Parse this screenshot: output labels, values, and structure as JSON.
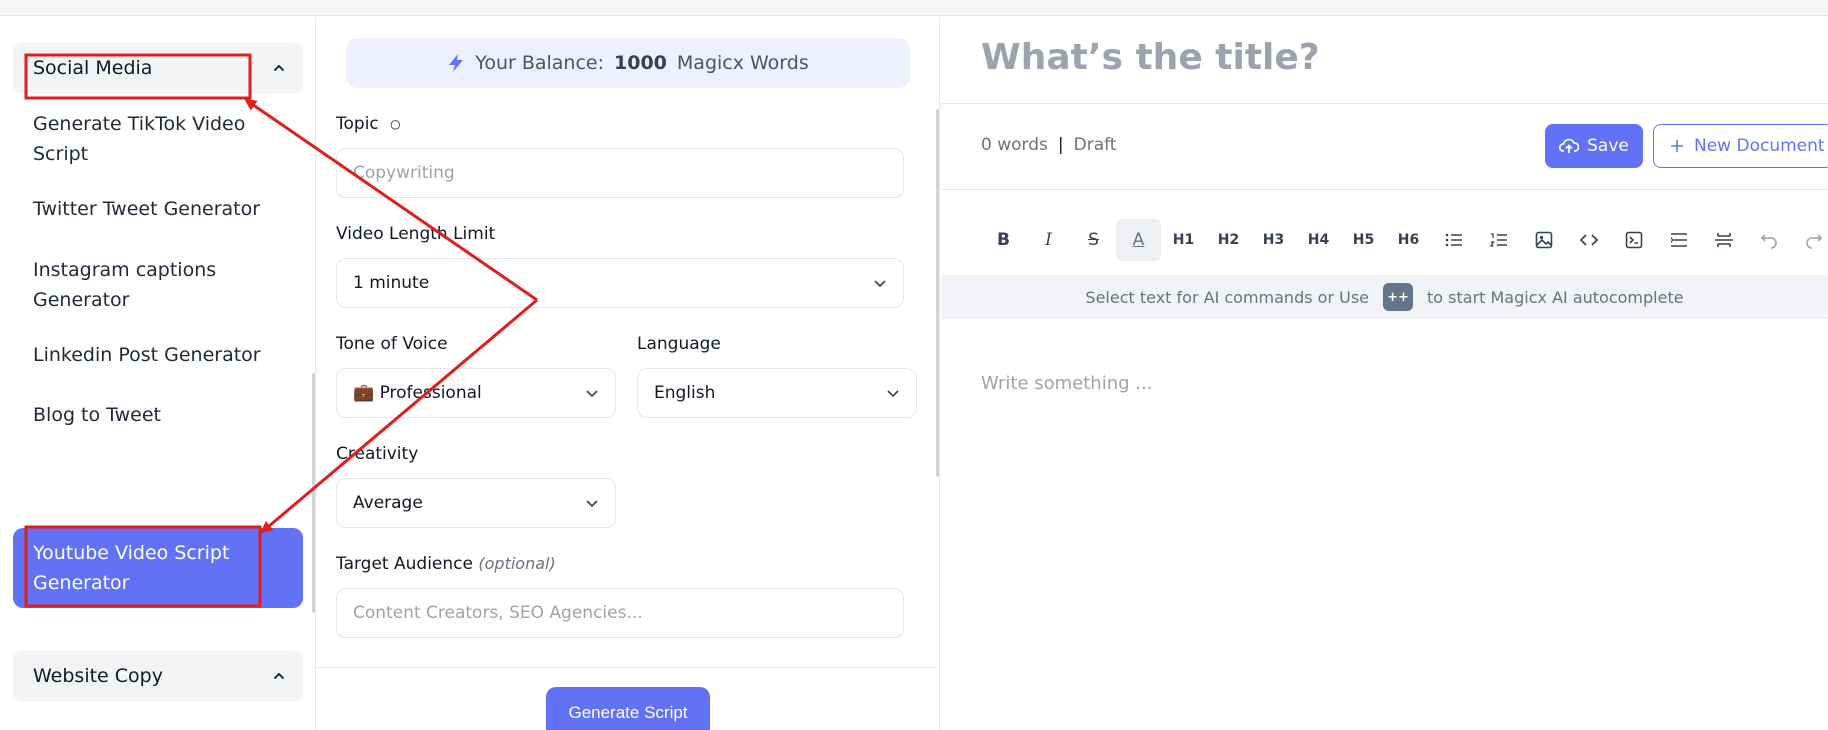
{
  "sidebar": {
    "categories": [
      {
        "label": "Social Media"
      },
      {
        "label": "Website Copy"
      }
    ],
    "items": [
      {
        "label": "Generate TikTok Video Script"
      },
      {
        "label": "Twitter Tweet Generator"
      },
      {
        "label": "Instagram captions Generator"
      },
      {
        "label": "Linkedin Post Generator"
      },
      {
        "label": "Blog to Tweet"
      },
      {
        "label": "Youtube Video Script Generator"
      }
    ]
  },
  "form": {
    "balance_prefix": "Your Balance:",
    "balance_value": "1000",
    "balance_suffix": "Magicx Words",
    "topic_label": "Topic",
    "topic_placeholder": "Copywriting",
    "video_length_label": "Video Length Limit",
    "video_length_value": "1 minute",
    "tone_label": "Tone of Voice",
    "tone_value": "💼 Professional",
    "language_label": "Language",
    "language_value": "English",
    "creativity_label": "Creativity",
    "creativity_value": "Average",
    "audience_label": "Target Audience",
    "audience_optional": "(optional)",
    "audience_placeholder": "Content Creators, SEO Agencies...",
    "generate_label": "Generate Script"
  },
  "editor": {
    "title_placeholder": "What’s the title?",
    "word_count": "0 words",
    "separator": "|",
    "status": "Draft",
    "save_label": "Save",
    "new_document_label": "New Document",
    "toolbar": [
      "B",
      "I",
      "S",
      "A",
      "H1",
      "H2",
      "H3",
      "H4",
      "H5",
      "H6"
    ],
    "hint_prefix": "Select text for AI commands or Use",
    "hint_key": "++",
    "hint_suffix": "to start Magicx AI autocomplete",
    "body_placeholder": "Write something ..."
  },
  "colors": {
    "accent": "#6272f7",
    "annotation": "#e11d1d"
  }
}
